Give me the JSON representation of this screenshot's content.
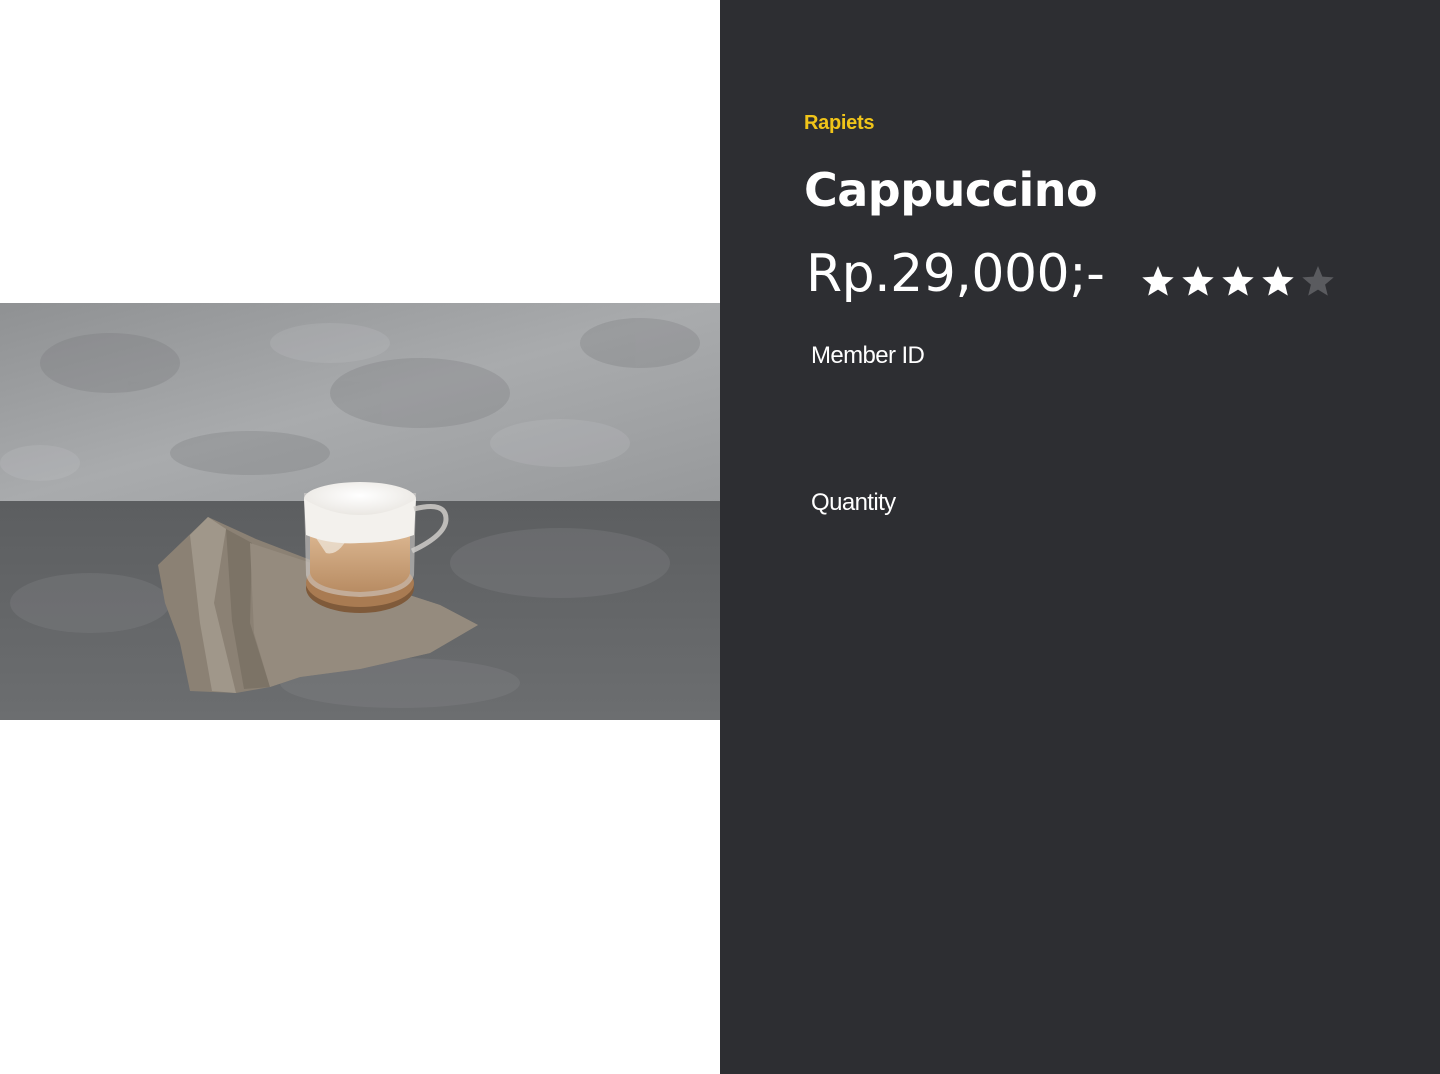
{
  "product": {
    "brand": "Rapiets",
    "name": "Cappuccino",
    "price": "Rp.29,000;-",
    "rating": 4,
    "rating_max": 5,
    "image_alt": "Cappuccino in a glass cup on a cork coaster and linen napkin"
  },
  "form": {
    "member_id_label": "Member ID",
    "quantity_label": "Quantity"
  },
  "colors": {
    "panel_background": "#2d2e32",
    "brand_accent": "#f0c419",
    "star_filled": "#ffffff",
    "star_empty": "#5a5b5f"
  }
}
